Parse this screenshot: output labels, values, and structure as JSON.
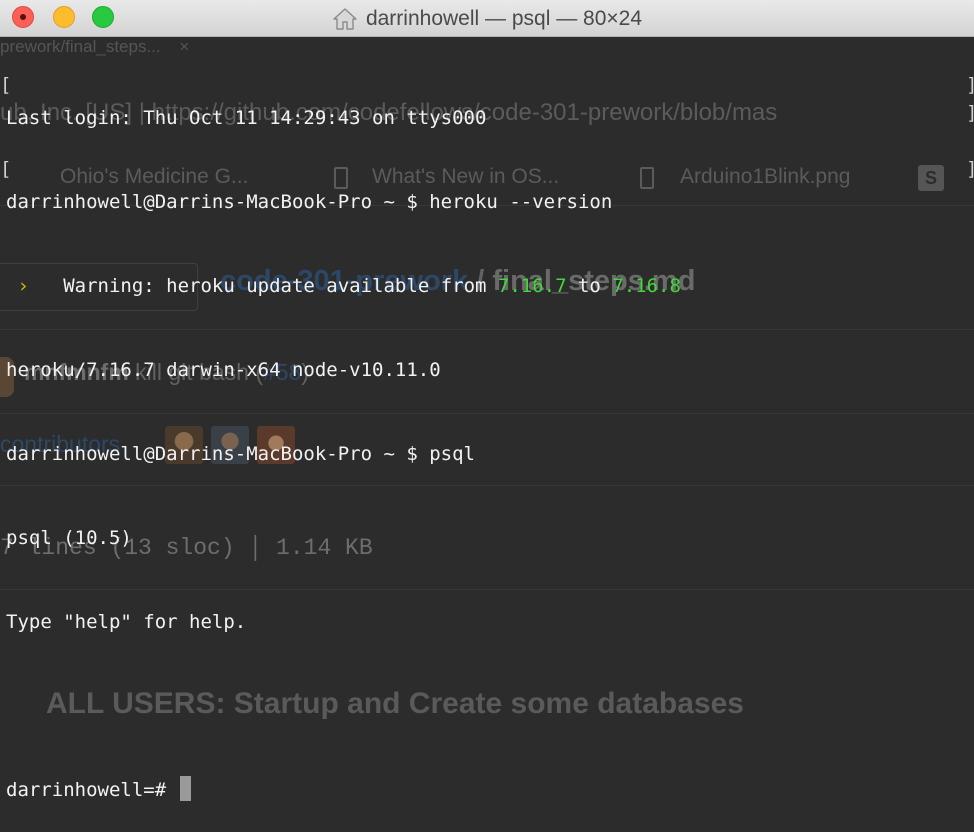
{
  "window": {
    "title": "darrinhowell — psql — 80×24"
  },
  "background_browser": {
    "tab_label": "prework/final_steps...",
    "tab_close": "×",
    "url_text": "ub, Inc. [US] | https://github.com/codefellows/code-301-prework/blob/mas",
    "bookmarks": [
      "Ohio's Medicine G...",
      "What's New in OS...",
      "Arduino1Blink.png"
    ],
    "bookmark_badge": "S",
    "repo_link": "code-301-prework",
    "repo_sep": " / ",
    "file_name": "final_steps.md",
    "commit_author": "mnfmnfm",
    "commit_message": " kill git bash (",
    "commit_pr": "#58",
    "commit_close": ")",
    "contributors_label": "contributors",
    "file_stats": "7 lines (13 sloc)  │  1.14 KB",
    "section_heading": "ALL USERS: Startup and Create some databases"
  },
  "terminal": {
    "last_login": "Last login: Thu Oct 11 14:29:43 on ttys000",
    "prompt1": "darrinhowell@Darrins-MacBook-Pro ~ $ heroku --version",
    "warning_arrow": " › ",
    "warning_text": "  Warning: heroku update available from ",
    "warning_from_version": "7.16.7",
    "warning_to": " to ",
    "warning_to_version": "7.16.8",
    "version_output": "heroku/7.16.7 darwin-x64 node-v10.11.0",
    "prompt2": "darrinhowell@Darrins-MacBook-Pro ~ $ psql",
    "psql_version": "psql (10.5)",
    "help_hint": "Type \"help\" for help.",
    "psql_prompt": "darrinhowell=# "
  },
  "colors": {
    "terminal_bg": "#2c2c2c",
    "accent_green": "#44d63b",
    "warning_yellow": "#c6c20b"
  }
}
